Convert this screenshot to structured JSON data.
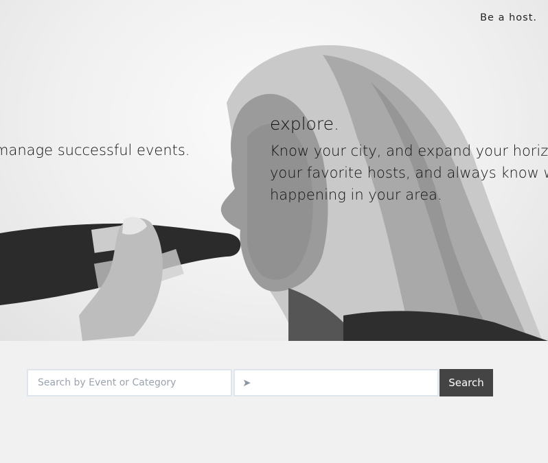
{
  "header": {
    "host_link": "Be a host."
  },
  "hero": {
    "left_slide_text": "manage successful events.",
    "right_slide": {
      "title": "explore.",
      "lines": [
        "Know your city, and expand your horizo",
        "your favorite hosts, and always know w",
        "happening in your area."
      ]
    }
  },
  "search": {
    "event_placeholder": "Search by Event or Category",
    "location_icon": "location-arrow-icon",
    "location_value": "",
    "button_label": "Search"
  },
  "colors": {
    "page_bg": "#f1f1f1",
    "button_bg": "#444444",
    "button_text": "#ffffff",
    "field_border": "#dfe5ec"
  }
}
